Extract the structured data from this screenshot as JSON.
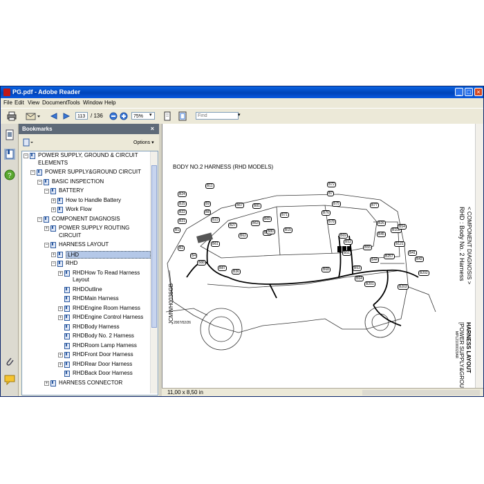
{
  "window": {
    "title": "PG.pdf - Adobe Reader",
    "buttons": {
      "minimize": "_",
      "maximize": "□",
      "close": "×"
    }
  },
  "menu": [
    "File",
    "Edit",
    "View",
    "Document",
    "Tools",
    "Window",
    "Help"
  ],
  "toolbar": {
    "page_current": "113",
    "page_total": "/ 136",
    "zoom": "75%",
    "find_placeholder": "Find"
  },
  "bookmarks": {
    "title": "Bookmarks",
    "close": "×",
    "options": "Options ▾",
    "items": [
      {
        "label": "POWER SUPPLY, GROUND & CIRCUIT",
        "label2": "ELEMENTS",
        "level": 0,
        "exp": "−"
      },
      {
        "label": "POWER SUPPLY&GROUND CIRCUIT",
        "level": 1,
        "exp": "−"
      },
      {
        "label": "BASIC INSPECTION",
        "level": 2,
        "exp": "−"
      },
      {
        "label": "BATTERY",
        "level": 3,
        "exp": "−"
      },
      {
        "label": "How to Handle Battery",
        "level": 4,
        "exp": "+"
      },
      {
        "label": "Work Flow",
        "level": 4,
        "exp": "+"
      },
      {
        "label": "COMPONENT DIAGNOSIS",
        "level": 2,
        "exp": "−"
      },
      {
        "label": "POWER SUPPLY ROUTING",
        "label2": "CIRCUIT",
        "level": 3,
        "exp": "+"
      },
      {
        "label": "HARNESS LAYOUT",
        "level": 3,
        "exp": "−"
      },
      {
        "label": "LHD",
        "level": 4,
        "exp": "+",
        "selected": true
      },
      {
        "label": "RHD",
        "level": 4,
        "exp": "−"
      },
      {
        "label": "RHDHow To Read Harness",
        "label2": "Layout",
        "level": 5,
        "exp": "+"
      },
      {
        "label": "RHDOutline",
        "level": 5,
        "exp": ""
      },
      {
        "label": "RHDMain Harness",
        "level": 5,
        "exp": ""
      },
      {
        "label": "RHDEngine Room Harness",
        "level": 5,
        "exp": "+"
      },
      {
        "label": "RHDEngine Control Harness",
        "level": 5,
        "exp": "+"
      },
      {
        "label": "RHDBody Harness",
        "level": 5,
        "exp": ""
      },
      {
        "label": "RHDBody No. 2 Harness",
        "level": 5,
        "exp": ""
      },
      {
        "label": "RHDRoom Lamp Harness",
        "level": 5,
        "exp": ""
      },
      {
        "label": "RHDFront Door Harness",
        "level": 5,
        "exp": "+"
      },
      {
        "label": "RHDRear Door Harness",
        "level": 5,
        "exp": "+"
      },
      {
        "label": "RHDBack Door Harness",
        "level": 5,
        "exp": ""
      },
      {
        "label": "HARNESS CONNECTOR",
        "level": 3,
        "exp": "+"
      }
    ]
  },
  "document": {
    "diagram_title": "BODY NO.2 HARNESS (RHD MODELS)",
    "side_header": "< COMPONENT DIAGNOSIS >",
    "side_subheader": "RHD : Body No. 2 Harness",
    "right_header": "HARNESS LAYOUT",
    "right_subheader": "[POWER SUPPLY&GROUND CIRCUIT]",
    "diagram_code": "JCMWH0036GB",
    "diagram_date": "2007/02/26",
    "ref_code": "MPL21000020AR",
    "connectors": [
      "B11",
      "B24",
      "B25",
      "B22",
      "B21",
      "B9",
      "B8",
      "B1",
      "B2",
      "B4",
      "B88",
      "B87",
      "B36",
      "B16",
      "B27",
      "B23",
      "B61",
      "B62",
      "B63",
      "B65",
      "B80",
      "B81",
      "B15",
      "B67",
      "B71",
      "B72",
      "B7",
      "B75",
      "B76",
      "B78",
      "B77",
      "B69",
      "B68",
      "B26",
      "B45",
      "B100",
      "B54",
      "B121",
      "B41",
      "B43",
      "B52",
      "B51",
      "B55",
      "B44",
      "B53",
      "B64",
      "B201",
      "B203",
      "B202",
      "B257"
    ]
  },
  "status": {
    "page_size": "11,00 x 8,50 in"
  }
}
